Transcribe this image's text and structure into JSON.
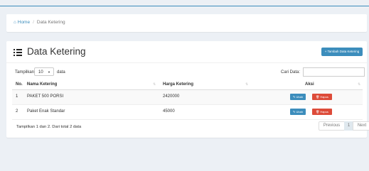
{
  "breadcrumb": {
    "home": "Home",
    "current": "Data Ketering",
    "separator": "/"
  },
  "page": {
    "title": "Data Ketering",
    "add_button": "+ Tambah Data Ketering"
  },
  "length": {
    "label": "Tampilkan",
    "value": "10",
    "suffix": "data"
  },
  "search": {
    "label": "Cari Data:",
    "value": ""
  },
  "table": {
    "columns": [
      "No.",
      "Nama Ketering",
      "Harga Ketering",
      "Aksi"
    ],
    "rows": [
      {
        "no": "1",
        "name": "PAKET 500 PORSI",
        "price": "2420000",
        "edit": "Ubah",
        "delete": "Hapus"
      },
      {
        "no": "2",
        "name": "Paket Enak Standar",
        "price": "45000",
        "edit": "Ubah",
        "delete": "Hapus"
      }
    ]
  },
  "info": "Tampilkan 1 dan 2. Dari total 2 data",
  "pagination": {
    "prev": "Previous",
    "current": "1",
    "next": "Next"
  },
  "icons": {
    "home": "home-icon",
    "title": "list-icon",
    "edit": "edit-icon",
    "delete": "trash-icon"
  },
  "colors": {
    "primary": "#3c8dbc",
    "danger": "#dd4b39",
    "background": "#ecf0f5"
  }
}
